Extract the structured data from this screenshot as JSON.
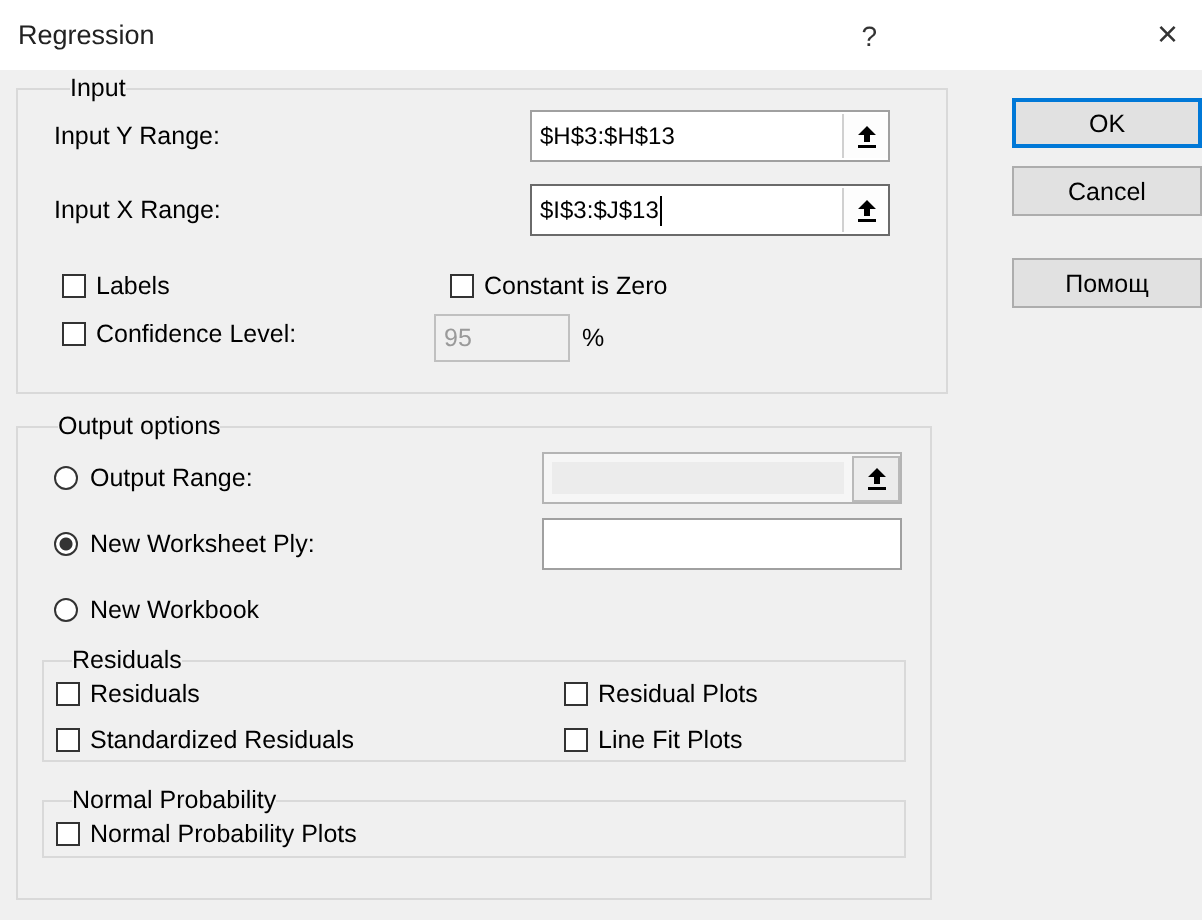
{
  "window": {
    "title": "Regression",
    "help_button": "?",
    "close_button": "×"
  },
  "input": {
    "title": "Input",
    "ranges": [
      {
        "label": "Input Y Range:",
        "value": "$H$3:$H$13",
        "focused": false
      },
      {
        "label": "Input X Range:",
        "value": "$I$3:$J$13",
        "focused": true
      }
    ],
    "labels_checkbox": {
      "label": "Labels",
      "checked": false
    },
    "constant_checkbox": {
      "label": "Constant is Zero",
      "checked": false
    },
    "confidence_checkbox": {
      "label": "Confidence Level:",
      "checked": false
    },
    "confidence_field": {
      "value": "95",
      "disabled": true
    },
    "confidence_unit": "%"
  },
  "output_options": {
    "title": "Output options",
    "choices": [
      {
        "label": "Output Range:",
        "selected": false,
        "field": {
          "disabled": true,
          "has_picker": true
        }
      },
      {
        "label": "New Worksheet Ply:",
        "selected": true,
        "field": {
          "disabled": false,
          "has_picker": false
        }
      },
      {
        "label": "New Workbook",
        "selected": false
      }
    ],
    "residuals": {
      "title": "Residuals",
      "options": [
        {
          "label": "Residuals",
          "checked": false
        },
        {
          "label": "Residual Plots",
          "checked": false
        },
        {
          "label": "Standardized Residuals",
          "checked": false
        },
        {
          "label": "Line Fit Plots",
          "checked": false
        }
      ]
    },
    "normal_probability": {
      "title": "Normal Probability",
      "options": [
        {
          "label": "Normal Probability Plots",
          "checked": false
        }
      ]
    }
  },
  "buttons": [
    {
      "label": "OK",
      "default": true
    },
    {
      "label": "Cancel",
      "default": false
    },
    {
      "label": "Помощ",
      "default": false
    }
  ]
}
